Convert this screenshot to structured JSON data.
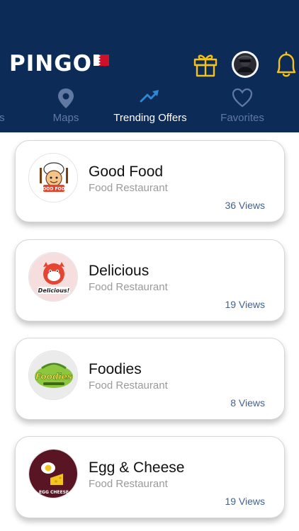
{
  "app": {
    "logo_text": "PINGO"
  },
  "header": {
    "gift_icon": "gift-icon",
    "avatar_icon": "avatar",
    "bell_icon": "bell-icon"
  },
  "tabs": [
    {
      "label": "Stores",
      "icon": "store-icon",
      "active": false
    },
    {
      "label": "Maps",
      "icon": "map-pin-icon",
      "active": false
    },
    {
      "label": "Trending Offers",
      "icon": "trending-up-icon",
      "active": true
    },
    {
      "label": "Favorites",
      "icon": "heart-icon",
      "active": false
    },
    {
      "label": "",
      "icon": "more-icon",
      "active": false
    }
  ],
  "restaurants": [
    {
      "name": "Good Food",
      "category": "Food Restaurant",
      "views": "36 Views",
      "logo_text": "GOOD FOOD"
    },
    {
      "name": "Delicious",
      "category": "Food Restaurant",
      "views": "19 Views",
      "logo_text": "Delicious!"
    },
    {
      "name": "Foodies",
      "category": "Food Restaurant",
      "views": "8 Views",
      "logo_text": "Foodies"
    },
    {
      "name": "Egg & Cheese",
      "category": "Food Restaurant",
      "views": "19 Views",
      "logo_text": "EGG CHEESE"
    }
  ],
  "colors": {
    "header_bg": "#0d2b57",
    "tab_inactive": "#5f79a3",
    "tab_active": "#ffffff",
    "gift": "#f2c21b",
    "views_text": "#44628f"
  }
}
